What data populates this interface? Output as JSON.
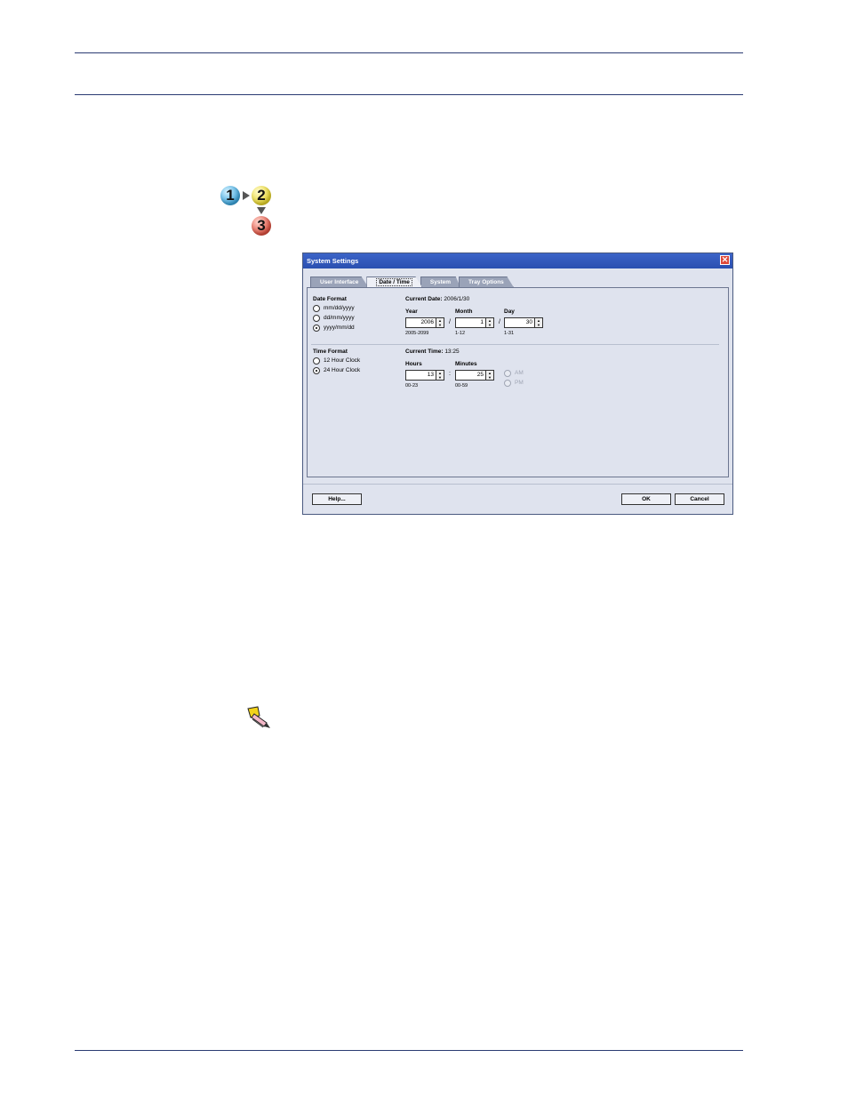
{
  "dialog": {
    "title": "System Settings",
    "close": "✕",
    "tabs": [
      "User Interface",
      "Date / Time",
      "System",
      "Tray Options"
    ],
    "date": {
      "format_label": "Date Format",
      "options": [
        "mm/dd/yyyy",
        "dd/mm/yyyy",
        "yyyy/mm/dd"
      ],
      "selected": "yyyy/mm/dd",
      "current_label": "Current Date:",
      "current_value": "2006/1/30",
      "year_label": "Year",
      "year_value": "2006",
      "year_range": "2005-2099",
      "month_label": "Month",
      "month_value": "1",
      "month_range": "1-12",
      "day_label": "Day",
      "day_value": "30",
      "day_range": "1-31",
      "separator": "/"
    },
    "time": {
      "format_label": "Time Format",
      "options": [
        "12 Hour Clock",
        "24 Hour Clock"
      ],
      "selected": "24 Hour Clock",
      "current_label": "Current Time:",
      "current_value": "13:25",
      "hours_label": "Hours",
      "hours_value": "13",
      "hours_range": "00-23",
      "minutes_label": "Minutes",
      "minutes_value": "25",
      "minutes_range": "00-59",
      "separator": ":",
      "am": "AM",
      "pm": "PM"
    },
    "buttons": {
      "help": "Help...",
      "ok": "OK",
      "cancel": "Cancel"
    }
  },
  "steps_icon": {
    "numbers": [
      "1",
      "2",
      "3"
    ]
  },
  "icons": {
    "note": "pencil-note-icon",
    "steps": "steps-icon"
  },
  "colors": {
    "rule": "#2b3b73",
    "titlebar": "#2a4fb0",
    "dialog_bg": "#dfe3ee"
  }
}
